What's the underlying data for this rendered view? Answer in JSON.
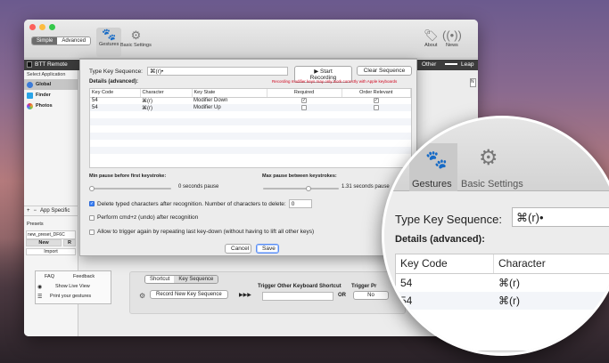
{
  "main_window": {
    "segmented": {
      "simple": "Simple",
      "advanced": "Advanced"
    },
    "toolbar": {
      "gestures": "Gestures",
      "basic_settings": "Basic Settings",
      "about": "About",
      "news": "News"
    },
    "appbar": {
      "title": "BTT Remote",
      "other": "Other",
      "leap": "Leap"
    },
    "sidebar": {
      "header": "Select Application",
      "items": [
        {
          "label": "Global",
          "color": "#3b7bd8"
        },
        {
          "label": "Finder",
          "color": "#2aa4e8"
        },
        {
          "label": "Photos",
          "color": "#e8a23b"
        }
      ],
      "app_specific": "App Specific",
      "presets_label": "Presets",
      "preset_name": "new_preset_DF6C",
      "new": "New",
      "r": "R",
      "import": "Import",
      "faq": "FAQ",
      "feedback": "Feedback",
      "show_live_view": "Show Live View",
      "print_gestures": "Print your gestures"
    },
    "lower_panel": {
      "shortcut_tab": "Shortcut",
      "key_sequence_tab": "Key Sequence",
      "record_button": "Record New Key Sequence",
      "arrows": "▶▶▶",
      "trigger_other_label": "Trigger Other Keyboard Shortcut",
      "or": "OR",
      "trigger_pr": "Trigger Pr",
      "no": "No"
    }
  },
  "dialog": {
    "type_key_sequence_label": "Type Key Sequence:",
    "sequence_value": "⌘(r)•",
    "start_recording": "Start Recording",
    "start_recording_icon": "play-icon",
    "clear_sequence": "Clear Sequence",
    "details_label": "Details (advanced):",
    "warning": "Recording modifier keys may only work correctly with Apple keyboards",
    "warning_color": "#d0021b",
    "columns": [
      "Key Code",
      "Character",
      "Key State",
      "Required",
      "Order Relevant"
    ],
    "rows": [
      {
        "key_code": "54",
        "character": "⌘(r)",
        "key_state": "Modifier Down",
        "required": true,
        "order": true
      },
      {
        "key_code": "54",
        "character": "⌘(r)",
        "key_state": "Modifier Up",
        "required": false,
        "order": false
      }
    ],
    "min_pause_label": "Min pause before first keystroke:",
    "min_pause_value": "0 seconds pause",
    "min_pause_fraction": 0.0,
    "max_pause_label": "Max pause between keystrokes:",
    "max_pause_value": "1.31 seconds pause",
    "max_pause_fraction": 0.45,
    "delete_label": "Delete typed characters after recognition. Number of characters to delete:",
    "delete_checked": true,
    "delete_count": "0",
    "undo_label": "Perform cmd+z (undo) after recognition",
    "undo_checked": false,
    "repeat_label": "Allow to trigger again by repeating last key-down (without having to lift all other keys)",
    "repeat_checked": false,
    "cancel": "Cancel",
    "save": "Save"
  },
  "magnifier": {
    "gestures": "Gestures",
    "basic_settings": "Basic Settings",
    "type_key_sequence_label": "Type Key Sequence:",
    "sequence_value": "⌘(r)•",
    "details_label": "Details (advanced):",
    "columns": [
      "Key Code",
      "Character"
    ],
    "rows": [
      {
        "key_code": "54",
        "character": "⌘(r)"
      },
      {
        "key_code": "54",
        "character": "⌘(r)"
      }
    ]
  }
}
